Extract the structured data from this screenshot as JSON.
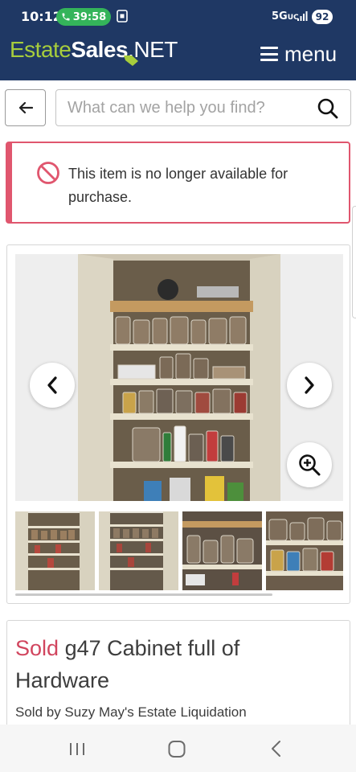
{
  "status_bar": {
    "time": "10:12",
    "call_duration": "39:58",
    "network": "5G",
    "network_sub": "UC",
    "battery": "92"
  },
  "header": {
    "logo_part1": "Estate",
    "logo_part2": "Sales",
    "logo_part3": ".NET",
    "menu_label": "menu"
  },
  "search": {
    "placeholder": "What can we help you find?"
  },
  "alert": {
    "message": "This item is no longer available for purchase."
  },
  "item": {
    "status_word": "Sold",
    "title": "g47 Cabinet full of Hardware",
    "seller": "Sold by Suzy May's Estate Liquidation"
  },
  "colors": {
    "header_bg": "#1f3864",
    "logo_green": "#a7cd3c",
    "alert_accent": "#e0566e",
    "sold_red": "#d1455e"
  }
}
